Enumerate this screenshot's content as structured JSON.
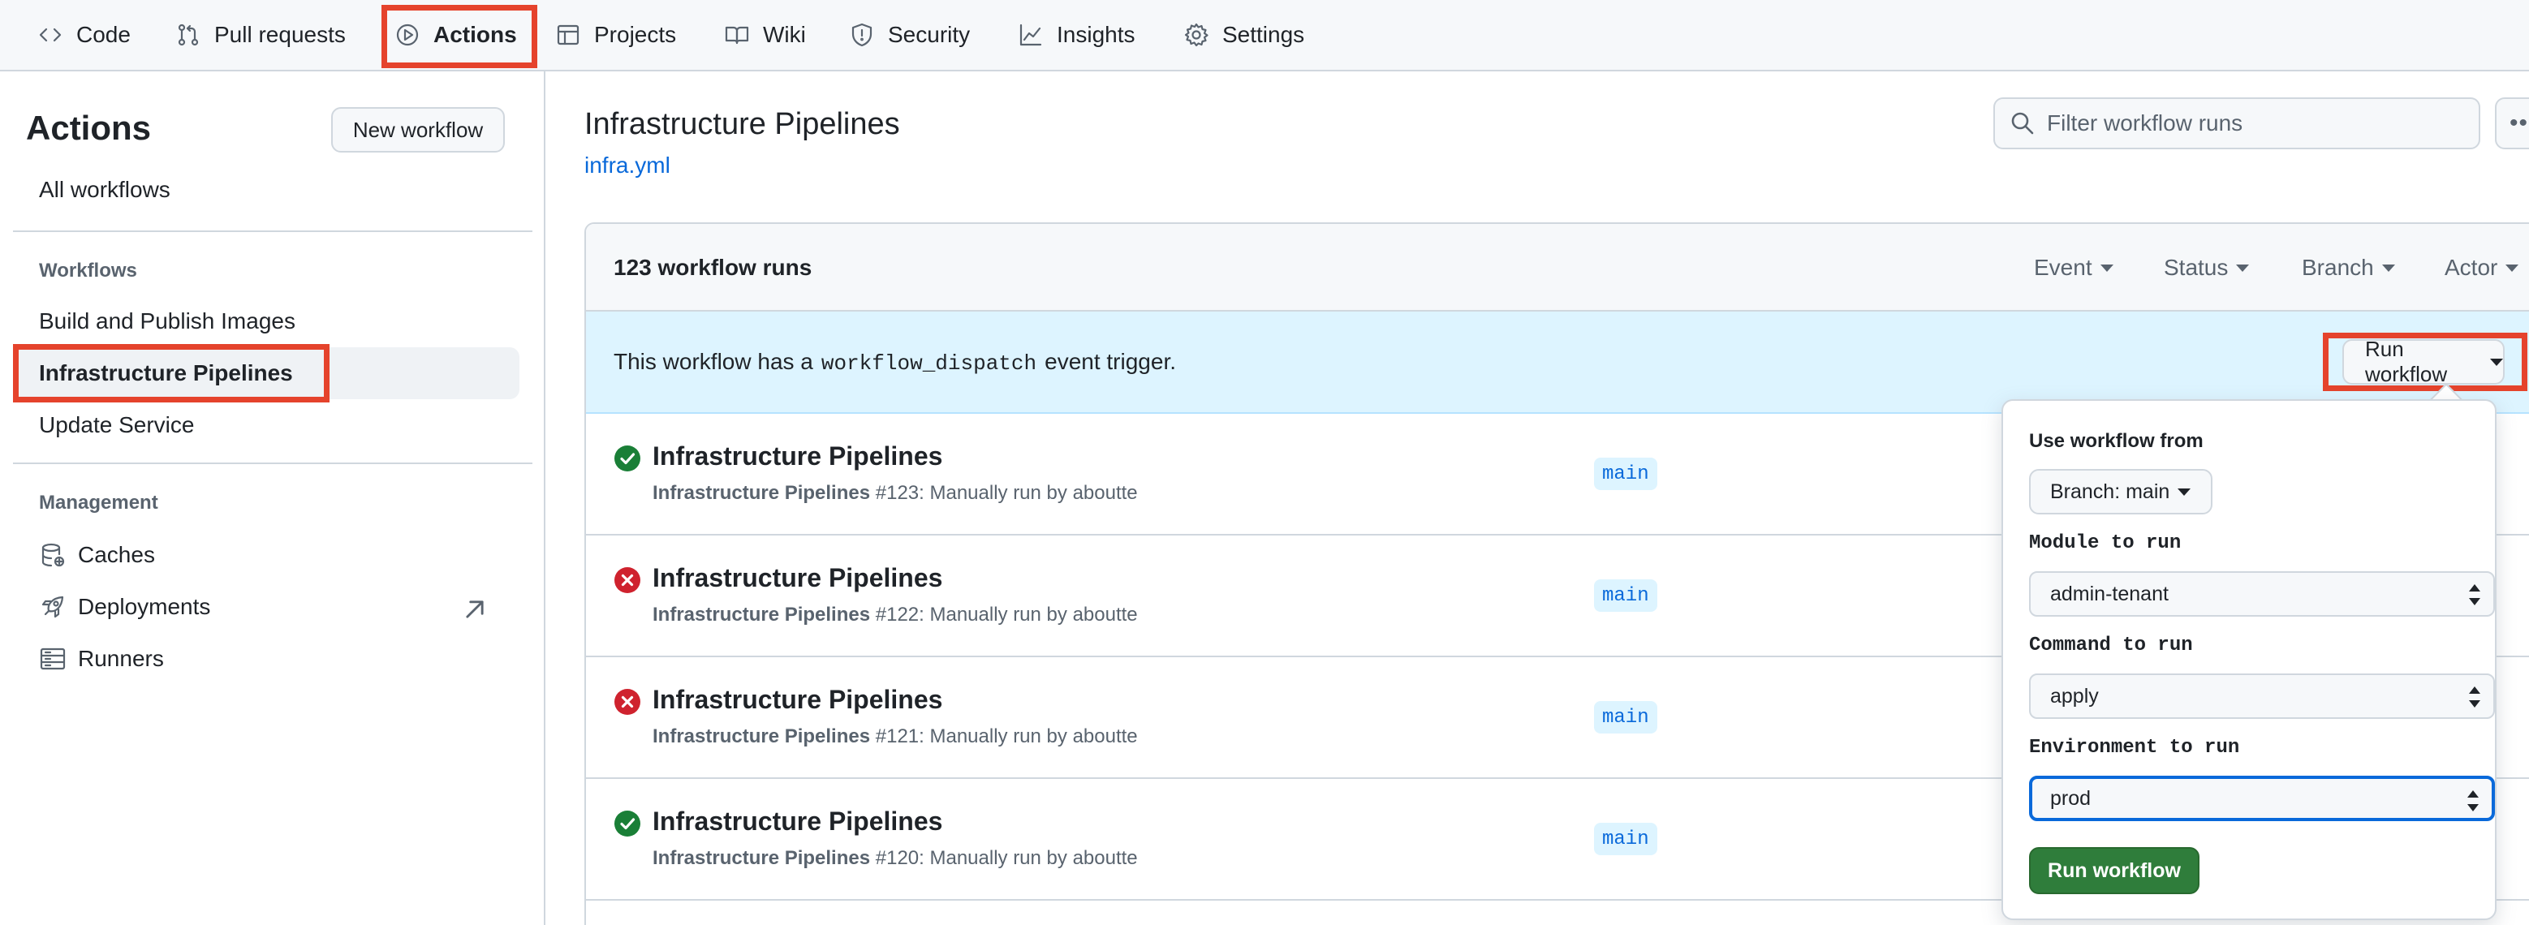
{
  "repo_nav": {
    "tabs": [
      {
        "label": "Code",
        "icon": "code-icon"
      },
      {
        "label": "Pull requests",
        "icon": "pull-request-icon"
      },
      {
        "label": "Actions",
        "icon": "play-icon",
        "active": true
      },
      {
        "label": "Projects",
        "icon": "table-icon"
      },
      {
        "label": "Wiki",
        "icon": "book-icon"
      },
      {
        "label": "Security",
        "icon": "shield-icon"
      },
      {
        "label": "Insights",
        "icon": "graph-icon"
      },
      {
        "label": "Settings",
        "icon": "gear-icon"
      }
    ]
  },
  "sidebar": {
    "title": "Actions",
    "new_workflow_label": "New workflow",
    "all_workflows_label": "All workflows",
    "workflows_heading": "Workflows",
    "workflows": [
      {
        "label": "Build and Publish Images"
      },
      {
        "label": "Infrastructure Pipelines",
        "selected": true
      },
      {
        "label": "Update Service"
      }
    ],
    "management_heading": "Management",
    "management": [
      {
        "label": "Caches",
        "icon": "database-icon"
      },
      {
        "label": "Deployments",
        "icon": "rocket-icon"
      },
      {
        "label": "Runners",
        "icon": "server-icon"
      }
    ]
  },
  "main": {
    "title": "Infrastructure Pipelines",
    "file": "infra.yml",
    "filter_placeholder": "Filter workflow runs",
    "more_label": "••"
  },
  "runs": {
    "count_label": "123 workflow runs",
    "filters": [
      "Event",
      "Status",
      "Branch",
      "Actor"
    ],
    "dispatch_prefix": "This workflow has a",
    "dispatch_code": "workflow_dispatch",
    "dispatch_suffix": "event trigger.",
    "run_workflow_label": "Run workflow",
    "items": [
      {
        "title": "Infrastructure Pipelines",
        "workflow": "Infrastructure Pipelines",
        "detail": "#123: Manually run by aboutte",
        "branch": "main",
        "status": "success"
      },
      {
        "title": "Infrastructure Pipelines",
        "workflow": "Infrastructure Pipelines",
        "detail": "#122: Manually run by aboutte",
        "branch": "main",
        "status": "failure"
      },
      {
        "title": "Infrastructure Pipelines",
        "workflow": "Infrastructure Pipelines",
        "detail": "#121: Manually run by aboutte",
        "branch": "main",
        "status": "failure"
      },
      {
        "title": "Infrastructure Pipelines",
        "workflow": "Infrastructure Pipelines",
        "detail": "#120: Manually run by aboutte",
        "branch": "main",
        "status": "success"
      }
    ]
  },
  "dispatch_form": {
    "use_from_label": "Use workflow from",
    "branch_label": "Branch: main",
    "module_label": "Module to run",
    "module_value": "admin-tenant",
    "command_label": "Command to run",
    "command_value": "apply",
    "environment_label": "Environment to run",
    "environment_value": "prod",
    "submit_label": "Run workflow"
  },
  "colors": {
    "highlight_box": "#e5432c",
    "success": "#1a7f37",
    "failure": "#cf222e",
    "link": "#0969da",
    "primary_button": "#2f7d3b",
    "dispatch_banner": "#ddf4ff"
  }
}
